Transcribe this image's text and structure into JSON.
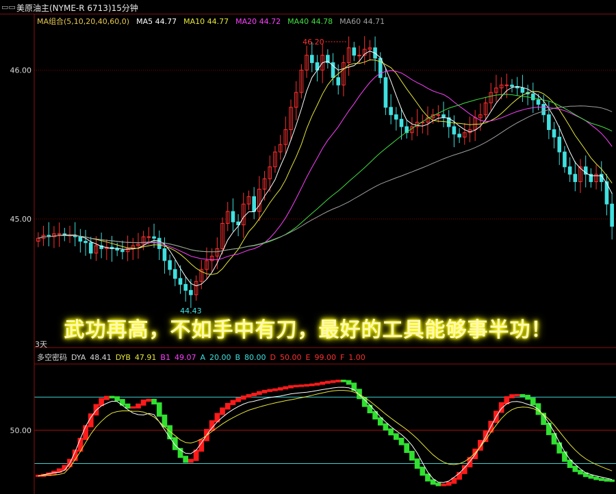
{
  "window": {
    "icon": "restore-icon",
    "title": "美原油主(NYME-R 6713)15分钟"
  },
  "ma_legend": [
    {
      "label": "MA组合(5,10,20,40,60,0)",
      "color": "#e8c850"
    },
    {
      "label": "MA5 44.77",
      "color": "#ffffff"
    },
    {
      "label": "MA10 44.77",
      "color": "#e8e83a"
    },
    {
      "label": "MA20 44.72",
      "color": "#ff40ff"
    },
    {
      "label": "MA40 44.78",
      "color": "#40e040"
    },
    {
      "label": "MA60 44.71",
      "color": "#a0a0a0"
    }
  ],
  "indicator_legend": [
    {
      "label": "多空密码",
      "color": "#d8d8d8"
    },
    {
      "label": "DYA",
      "color": "#d8d8d8"
    },
    {
      "label": "48.41",
      "color": "#d8d8d8"
    },
    {
      "label": "DYB",
      "color": "#e8e83a"
    },
    {
      "label": "47.91",
      "color": "#e8e83a"
    },
    {
      "label": "B1",
      "color": "#ff40ff"
    },
    {
      "label": "49.07",
      "color": "#ff40ff"
    },
    {
      "label": "A",
      "color": "#40e0e0"
    },
    {
      "label": "20.00",
      "color": "#40e0e0"
    },
    {
      "label": "B",
      "color": "#40e0e0"
    },
    {
      "label": "80.00",
      "color": "#40e0e0"
    },
    {
      "label": "D",
      "color": "#ff3030"
    },
    {
      "label": "50.00",
      "color": "#ff3030"
    },
    {
      "label": "E",
      "color": "#ff3030"
    },
    {
      "label": "99.00",
      "color": "#ff3030"
    },
    {
      "label": "F",
      "color": "#ff3030"
    },
    {
      "label": "1.00",
      "color": "#ff3030"
    }
  ],
  "banner": "武功再高，不如手中有刀，最好的工具能够事半功！",
  "period_label": "3天",
  "colors": {
    "up": "#ff3030",
    "down": "#40e0e0",
    "grid": "#8b0000",
    "axis": "#8b1010"
  },
  "chart_data": [
    {
      "type": "candlestick",
      "title": "美原油主(NYME-R 6713)15分钟",
      "y_ticks": [
        45.0,
        46.0
      ],
      "ylim": [
        44.31,
        46.37
      ],
      "annotations": [
        {
          "text": "46.20",
          "value": 46.2,
          "kind": "high"
        },
        {
          "text": "44.43",
          "value": 44.43,
          "kind": "low"
        }
      ],
      "grid": true,
      "close": [
        44.87,
        44.89,
        44.88,
        44.9,
        44.9,
        44.89,
        44.89,
        44.88,
        44.85,
        44.84,
        44.77,
        44.82,
        44.8,
        44.81,
        44.8,
        44.79,
        44.78,
        44.8,
        44.82,
        44.83,
        44.88,
        44.88,
        44.87,
        44.8,
        44.72,
        44.66,
        44.6,
        44.56,
        44.52,
        44.49,
        44.58,
        44.66,
        44.72,
        44.75,
        44.8,
        44.97,
        45.05,
        44.98,
        44.96,
        45.1,
        45.15,
        45.05,
        45.2,
        45.27,
        45.35,
        45.45,
        45.5,
        45.6,
        45.75,
        45.85,
        46.0,
        46.1,
        46.05,
        46.0,
        46.1,
        46.05,
        45.95,
        45.9,
        46.05,
        46.15,
        46.1,
        46.1,
        46.14,
        46.15,
        46.08,
        45.95,
        45.75,
        45.7,
        45.67,
        45.62,
        45.58,
        45.62,
        45.65,
        45.65,
        45.68,
        45.7,
        45.7,
        45.68,
        45.62,
        45.57,
        45.55,
        45.58,
        45.6,
        45.68,
        45.7,
        45.78,
        45.85,
        45.88,
        45.9,
        45.9,
        45.89,
        45.88,
        45.85,
        45.84,
        45.8,
        45.77,
        45.7,
        45.6,
        45.55,
        45.45,
        45.35,
        45.3,
        45.25,
        45.35,
        45.3,
        45.25,
        45.3,
        45.25,
        45.1,
        44.95
      ]
    },
    {
      "type": "line",
      "title": "多空密码",
      "y_ticks": [
        50.0
      ],
      "ylim": [
        -5,
        108
      ],
      "reference_lines": [
        {
          "name": "A",
          "value": 20
        },
        {
          "name": "B",
          "value": 80
        }
      ],
      "series": [
        {
          "name": "DYA",
          "values": [
            8.66,
            9.8,
            10.83,
            11.79,
            12.11,
            13.97,
            20.24,
            30.66,
            42.43,
            53.62,
            61.74,
            68.11,
            72.08,
            74.36,
            76.28,
            76.04,
            72.49,
            68.72,
            65.59,
            64.15,
            63.86,
            65.26,
            64.21,
            57.68,
            50.58,
            43.4,
            36.71,
            32.38,
            29.25,
            28.95,
            32.2,
            38.6,
            45.81,
            52.12,
            57.46,
            61.79,
            65.55,
            68.73,
            71.43,
            73.73,
            75.42,
            76.29,
            77.5,
            78.72,
            79.57,
            80.25,
            80.91,
            81.94,
            82.96,
            83.46,
            83.95,
            84.43,
            85.12,
            85.93,
            86.74,
            87.53,
            88.21,
            88.81,
            88.86,
            88.34,
            86.59,
            81.94,
            77.53,
            72.82,
            67.41,
            62.15,
            57.59,
            53.33,
            49.64,
            46.22,
            41.91,
            36.52,
            29.5,
            20.68,
            12.32,
            6.36,
            3.12,
            2.9,
            4.28,
            7.63,
            11.32,
            16.22,
            21.77,
            28.13,
            35.59,
            44.04,
            53.54,
            62.44,
            69.72,
            73.86,
            75.81,
            76.09,
            75.06,
            73.39,
            71.85,
            68.91,
            63.63,
            56.54,
            48.49,
            39.39,
            30.76,
            23.85,
            19.33,
            15.11,
            11.71,
            10.1,
            8.9,
            7.85,
            6.71,
            5.67
          ]
        },
        {
          "name": "DYB",
          "values": [
            9,
            9.28,
            9.45,
            9.7,
            10.19,
            11.51,
            16.52,
            23.52,
            30.84,
            38.91,
            46.75,
            53.13,
            58.12,
            62.46,
            65.55,
            66.92,
            67.56,
            67.57,
            67.16,
            67.2,
            66.49,
            64.59,
            62.05,
            57.77,
            53.01,
            49.04,
            45.19,
            41.39,
            38.99,
            38.56,
            39.91,
            42.22,
            45.4,
            48.98,
            52.43,
            55.77,
            58.79,
            61.44,
            63.89,
            66.15,
            68.15,
            69.68,
            71.08,
            72.41,
            73.59,
            74.72,
            75.79,
            76.75,
            77.62,
            78.52,
            79.49,
            80.47,
            81.6,
            82.72,
            83.81,
            84.8,
            85.59,
            86.01,
            86.01,
            85.63,
            84.45,
            82.46,
            79.68,
            76.28,
            72.5,
            68.57,
            64.68,
            60.99,
            57.51,
            54.07,
            50.61,
            46.76,
            42.45,
            37.55,
            32.57,
            27.92,
            24.12,
            21.36,
            19.59,
            19.08,
            19.81,
            21.86,
            25.18,
            29.62,
            35.09,
            41.39,
            48.17,
            54.74,
            60.66,
            65.39,
            68.66,
            70.43,
            71.01,
            70.78,
            69.66,
            67.54,
            64.34,
            60.04,
            54.85,
            49.01,
            43.01,
            37.3,
            32.23,
            27.86,
            24.32,
            21.5,
            19.15,
            17.08,
            15.17,
            13.43
          ]
        },
        {
          "name": "B1",
          "values": [
            8.98,
            9.77,
            11.03,
            12.66,
            14.68,
            17.74,
            23.33,
            31.68,
            42.26,
            53.69,
            64.33,
            72.79,
            78.27,
            80.16,
            79.76,
            77.34,
            73.24,
            70.58,
            70.7,
            73.22,
            76.79,
            77.48,
            74.29,
            63.28,
            53.68,
            42.8,
            33.12,
            26.05,
            21.64,
            23.3,
            31.68,
            41.12,
            50.31,
            58.12,
            64.76,
            69.69,
            73.76,
            76.44,
            78.65,
            80.46,
            81.71,
            82.92,
            84.44,
            85.58,
            86.29,
            86.91,
            87.88,
            88.84,
            89.73,
            90.08,
            90.42,
            90.77,
            91.3,
            92.02,
            93.01,
            93.66,
            94.27,
            94.76,
            94.38,
            92.09,
            86.51,
            79.11,
            72.07,
            66.32,
            60.71,
            55.32,
            50.74,
            46.39,
            42.36,
            37.51,
            30.53,
            23.65,
            16.26,
            9.99,
            4.81,
            1.87,
            0.54,
            0.98,
            2.74,
            6.37,
            11.46,
            17.5,
            24.92,
            32.58,
            40.4,
            48.87,
            57.67,
            66.72,
            74.42,
            79.81,
            81.62,
            81.74,
            81.09,
            78.56,
            73.52,
            64.83,
            55.81,
            46.61,
            38.18,
            30.04,
            22.58,
            16.97,
            13.37,
            11.08,
            8.76,
            7.29,
            6.06,
            5.27,
            4.66,
            4.41
          ]
        }
      ]
    }
  ]
}
